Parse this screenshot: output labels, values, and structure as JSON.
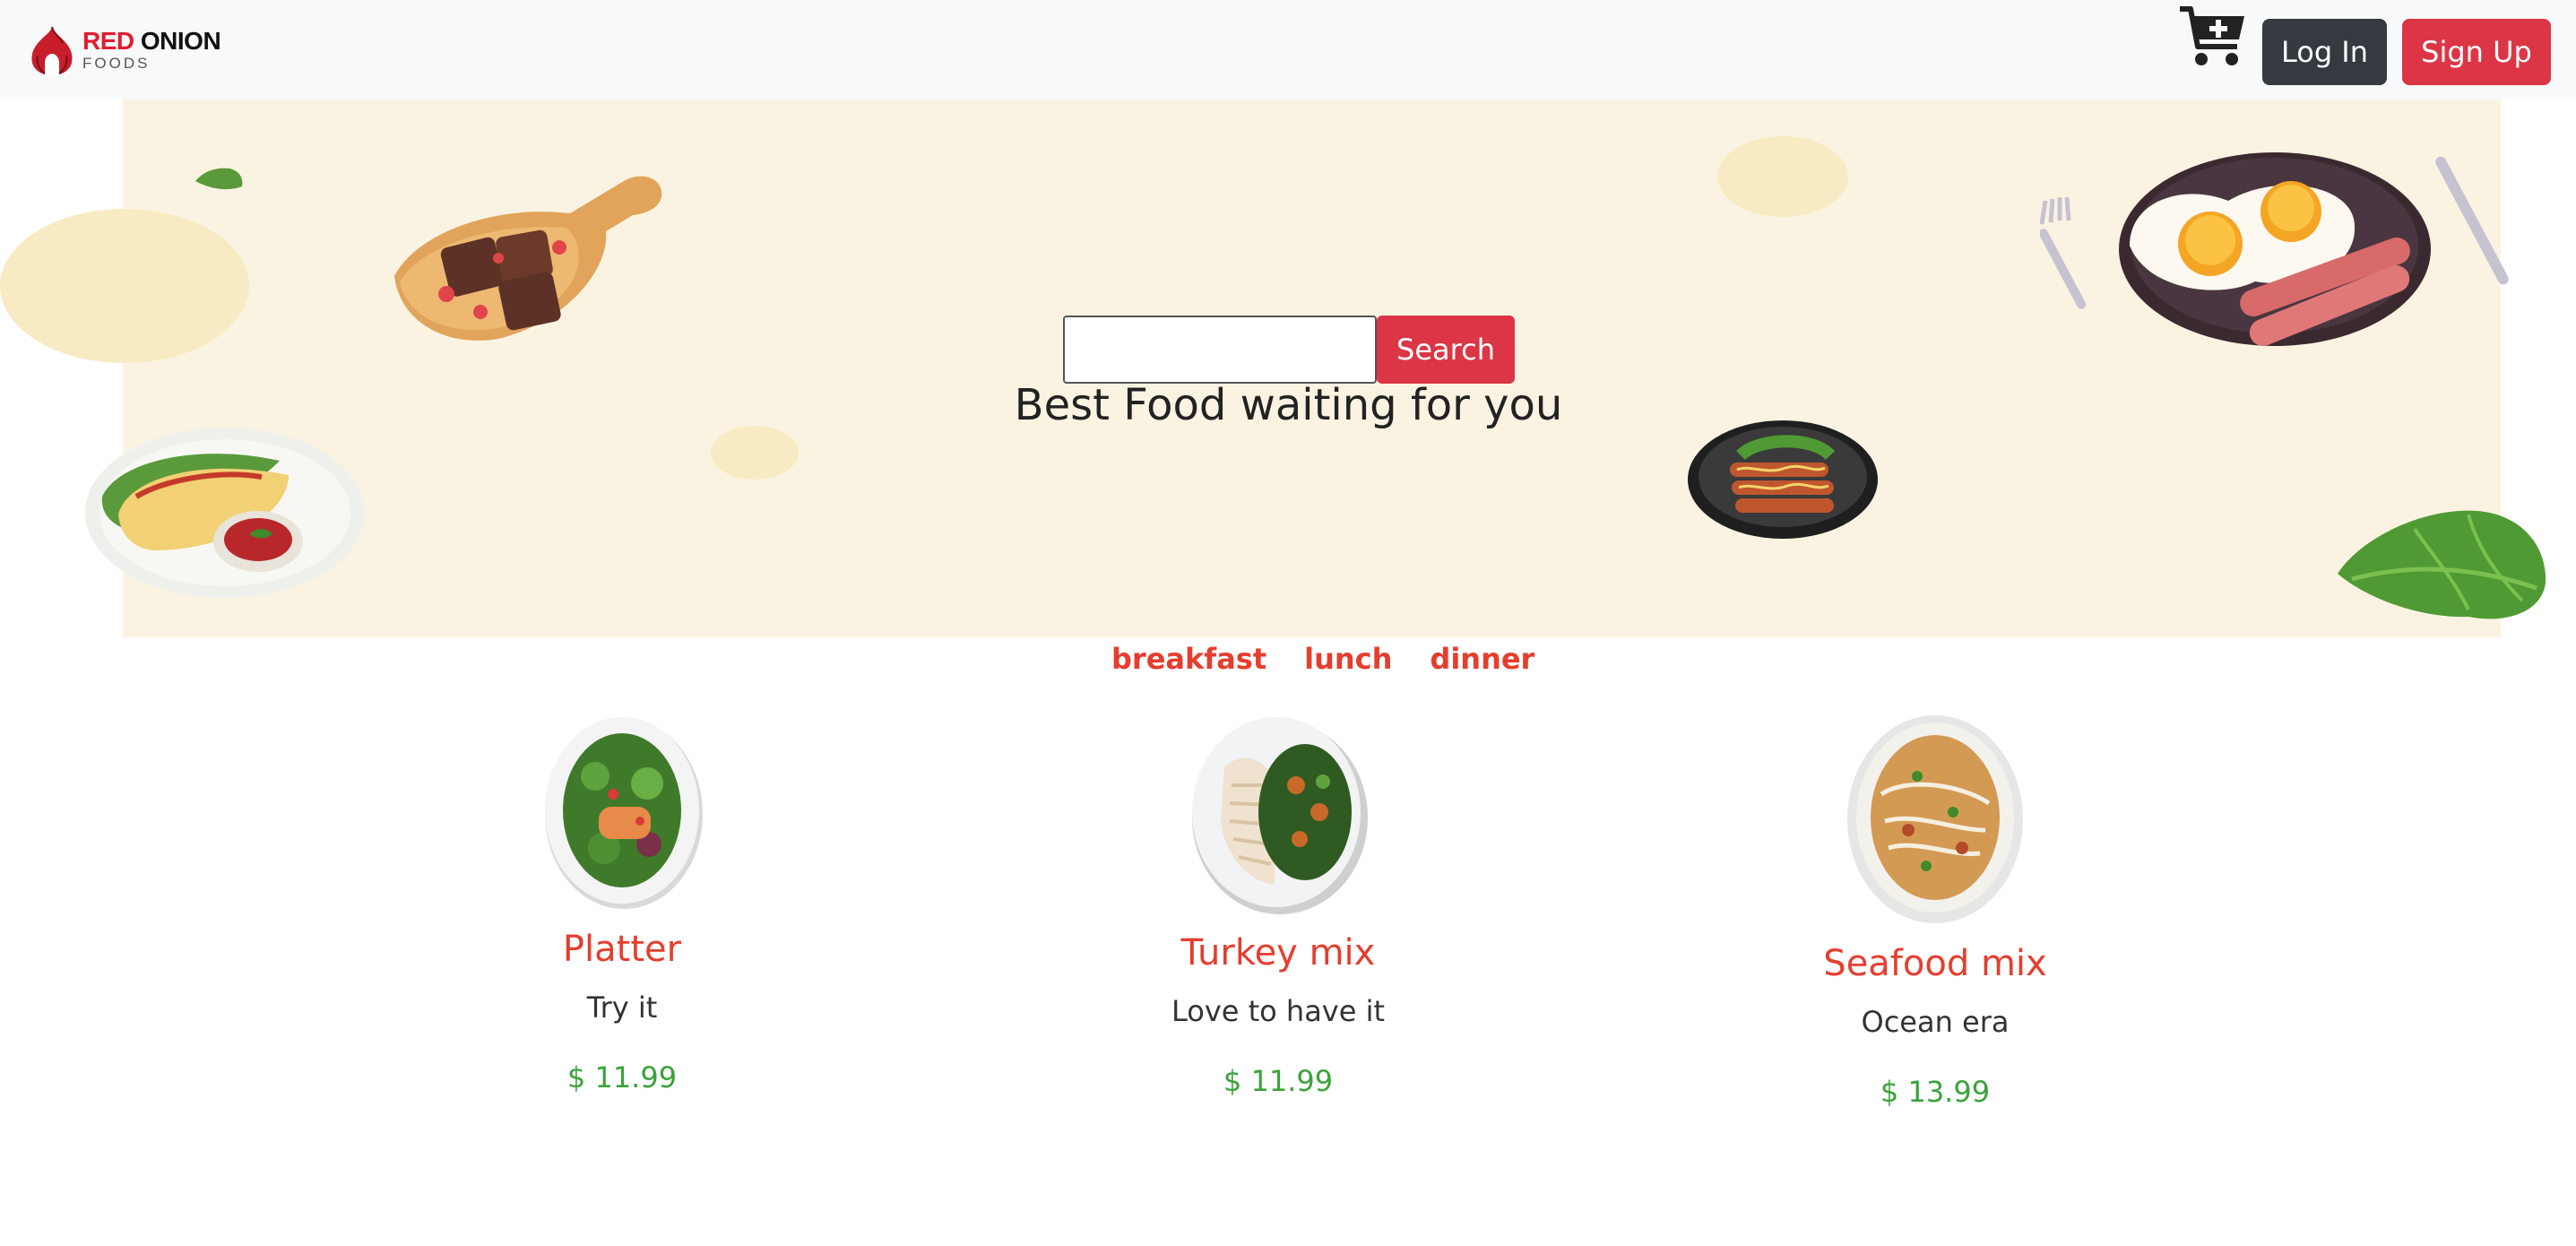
{
  "brand": {
    "name_red": "RED",
    "name_dark": "ONION",
    "sub": "FOODS"
  },
  "nav": {
    "cart_icon": "cart-plus-icon",
    "login_label": "Log In",
    "signup_label": "Sign Up"
  },
  "hero": {
    "search_placeholder": "",
    "search_value": "",
    "search_button": "Search",
    "tagline": "Best Food waiting for you"
  },
  "tabs": [
    "breakfast",
    "lunch",
    "dinner"
  ],
  "foods": [
    {
      "title": "Platter",
      "desc": "Try it",
      "price": "$ 11.99"
    },
    {
      "title": "Turkey mix",
      "desc": "Love to have it",
      "price": "$ 11.99"
    },
    {
      "title": "Seafood mix",
      "desc": "Ocean era",
      "price": "$ 13.99"
    }
  ],
  "colors": {
    "brand_red": "#dc3545",
    "accent_red": "#e53e2e",
    "price_green": "#3aa33a",
    "hero_bg": "#fbf3e2",
    "navbar_bg": "#f8f9fa",
    "dark_btn": "#343a40"
  }
}
